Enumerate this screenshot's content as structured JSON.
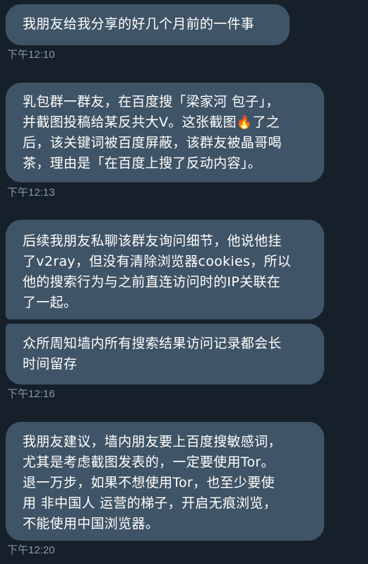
{
  "messages": [
    {
      "lines": [
        "我朋友给我分享的好几个月前的一件事"
      ]
    },
    {
      "lines": [
        "乳包群一群友，在百度搜「梁家河 包子」，",
        "并截图投稿给某反共大V。这张截图",
        "了之",
        "后，该关键词被百度屏蔽，该群友被晶哥喝",
        "茶，理由是「在百度上搜了反动内容」。"
      ]
    },
    {
      "lines": [
        "后续我朋友私聊该群友询问细节，他说他挂",
        "了v2ray，但没有清除浏览器cookies，所以",
        "他的搜索行为与之前直连访问时的IP关联在",
        "了一起。"
      ]
    },
    {
      "lines": [
        "众所周知墙内所有搜索结果访问记录都会长",
        "时间留存"
      ]
    },
    {
      "lines": [
        "我朋友建议，墙内朋友要上百度搜敏感词，",
        "尤其是考虑截图发表的，一定要使用Tor。",
        "退一万步，如果不想使用Tor，也至少要使",
        "用 非中国人 运营的梯子，开启无痕浏览，",
        "不能使用中国浏览器。"
      ]
    }
  ],
  "timestamps": [
    "下午12:10",
    "下午12:13",
    "下午12:16",
    "下午12:20"
  ],
  "icons": {
    "fire": "fire-emoji-icon"
  },
  "colors": {
    "background": "#15202b",
    "bubble": "#3f5466",
    "text": "#ffffff",
    "timestamp": "#8b98a5"
  }
}
